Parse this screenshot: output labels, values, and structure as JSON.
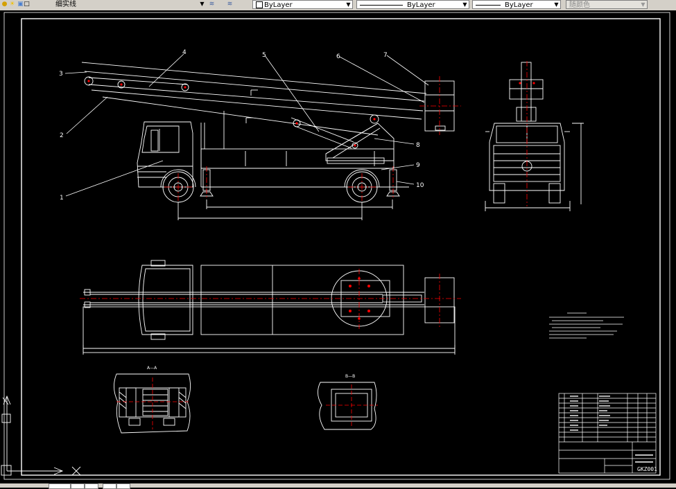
{
  "toolbar": {
    "linetype_label": "细实线",
    "layer_combo": "ByLayer",
    "linetype_combo": "ByLayer",
    "lineweight_combo": "ByLayer",
    "color_combo": "随颜色"
  },
  "drawing": {
    "side_view_callouts": [
      "1",
      "2",
      "3",
      "4",
      "5",
      "6",
      "7",
      "8",
      "9",
      "10"
    ],
    "section_a": "A—A",
    "section_b": "B—B",
    "drawing_number": "GKZ001"
  },
  "colors": {
    "background": "#000000",
    "linework": "#ffffff",
    "centerline": "#ff0000",
    "frame": "#ffffff"
  }
}
